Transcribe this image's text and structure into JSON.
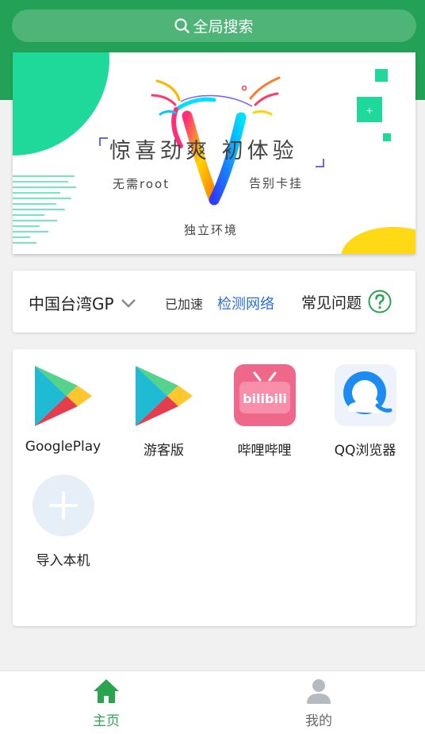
{
  "search": {
    "label": "全局搜索"
  },
  "banner": {
    "title": "惊喜劲爽  初体验",
    "no_root": "无需root",
    "no_plugin": "告别卡挂",
    "independent": "独立环境"
  },
  "network": {
    "region": "中国台湾GP",
    "status": "已加速",
    "detect": "检测网络",
    "faq": "常见问题"
  },
  "apps": [
    {
      "label": "GooglePlay",
      "icon": "google-play-icon"
    },
    {
      "label": "游客版",
      "icon": "google-play-icon"
    },
    {
      "label": "哔哩哔哩",
      "icon": "bilibili-icon",
      "icon_text": "bilibili"
    },
    {
      "label": "QQ浏览器",
      "icon": "qq-browser-icon"
    },
    {
      "label": "导入本机",
      "icon": "plus-icon"
    }
  ],
  "nav": {
    "home": "主页",
    "mine": "我的"
  },
  "colors": {
    "primary": "#23a257",
    "link": "#2b6fd1",
    "nav_active": "#2aa44f"
  }
}
